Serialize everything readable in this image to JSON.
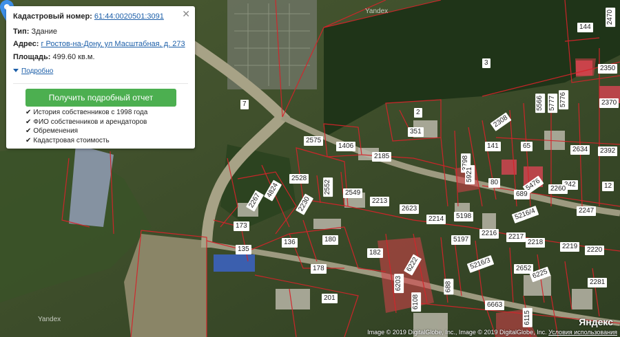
{
  "info_card": {
    "cadastral_label": "Кадастровый номер:",
    "cadastral_number": "61:44:0020501:3091",
    "type_label": "Тип:",
    "type_value": "Здание",
    "address_label": "Адрес:",
    "address_value": "г Ростов-на-Дону, ул Масштабная, д. 273",
    "area_label": "Площадь:",
    "area_value": "499.60 кв.м.",
    "more_link": "Подробно",
    "report_button": "Получить подробный отчет",
    "features": [
      "История собственников с 1998 года",
      "ФИО собственников и арендаторов",
      "Обременения",
      "Кадастровая стоимость"
    ],
    "check_glyph": "✔",
    "close_glyph": "✕"
  },
  "map": {
    "brand": "Яндекс",
    "watermark": "Yandex",
    "copyright": "Image © 2019 DigitalGlobe, Inc., Image © 2019 DigitalGlobe, Inc.",
    "terms_link": "Условия использования",
    "accent_color": "#4caf50",
    "link_color": "#1b5ea8",
    "parcel_border_color": "#d4242a",
    "parcel_fill_color": "#d8424a",
    "marker_color": "#3d8fe8",
    "parcel_labels": [
      "144",
      "2470",
      "3",
      "2350",
      "2370",
      "7",
      "5566",
      "5777",
      "5776",
      "2",
      "2575",
      "351",
      "2308",
      "1406",
      "141",
      "65",
      "2634",
      "2392",
      "2185",
      "3798",
      "2528",
      "2552",
      "2549",
      "5921",
      "80",
      "5476",
      "342",
      "2260",
      "12",
      "4824",
      "2213",
      "689",
      "2623",
      "2267",
      "2247",
      "2230",
      "5198",
      "5216/4",
      "173",
      "2216",
      "2214",
      "5197",
      "136",
      "180",
      "2217",
      "2218",
      "2219",
      "2220",
      "135",
      "182",
      "6225",
      "5216/3",
      "2652",
      "178",
      "6203",
      "6222",
      "6108",
      "688",
      "6663",
      "2281",
      "6115",
      "201"
    ]
  }
}
